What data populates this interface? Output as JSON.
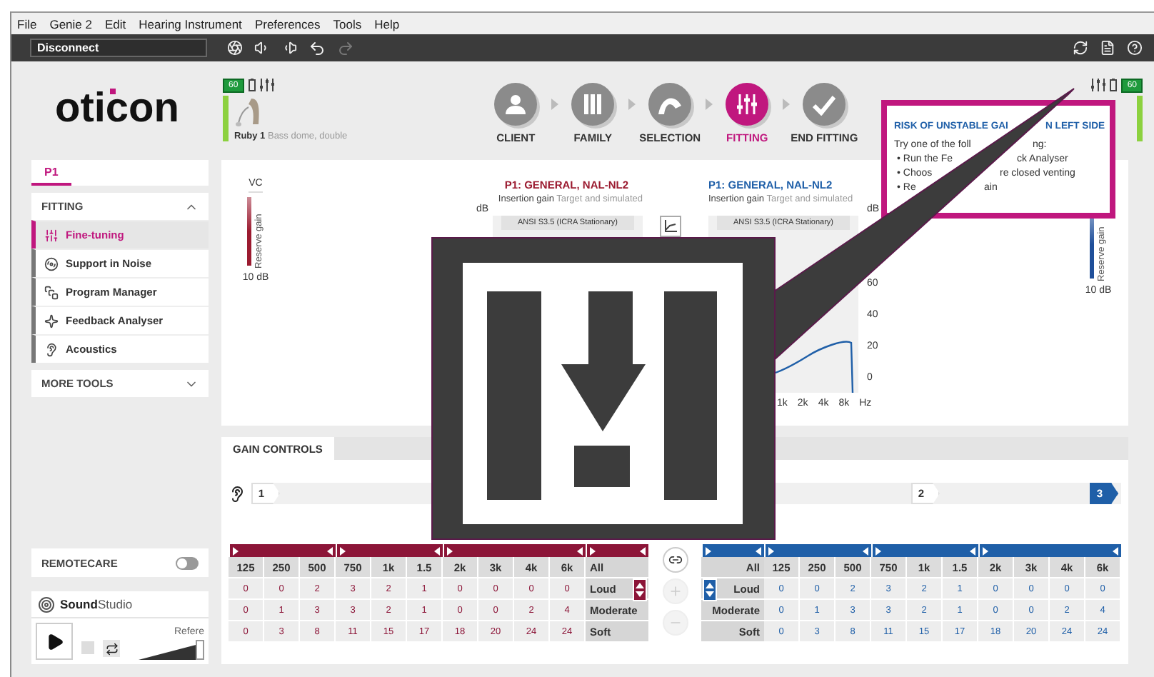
{
  "menu": [
    "File",
    "Genie 2",
    "Edit",
    "Hearing Instrument",
    "Preferences",
    "Tools",
    "Help"
  ],
  "toolbar": {
    "connection": "Disconnect",
    "redo_disabled": true
  },
  "logo": "oticon",
  "devices": [
    {
      "kind": "left",
      "battery": "60",
      "model": "Ruby 1",
      "fitting": "Bass dome, double"
    },
    {
      "kind": "right",
      "battery": "60"
    }
  ],
  "steps": [
    {
      "kind": "client",
      "label": "CLIENT",
      "selected": false
    },
    {
      "kind": "family",
      "label": "FAMILY",
      "selected": false
    },
    {
      "kind": "selection",
      "label": "SELECTION",
      "selected": false
    },
    {
      "kind": "fitting",
      "label": "FITTING",
      "selected": true
    },
    {
      "kind": "end",
      "label": "END FITTING",
      "selected": false
    }
  ],
  "program_tabs": [
    {
      "label": "P1",
      "selected": true
    }
  ],
  "fitting": {
    "title": "FITTING",
    "expanded": true,
    "items": [
      {
        "kind": "sliders",
        "label": "Fine-tuning",
        "selected": true
      },
      {
        "kind": "noise",
        "label": "Support in Noise",
        "selected": false
      },
      {
        "kind": "program",
        "label": "Program Manager",
        "selected": false
      },
      {
        "kind": "feedback",
        "label": "Feedback Analyser",
        "selected": false
      },
      {
        "kind": "acoustics",
        "label": "Acoustics",
        "selected": false
      }
    ]
  },
  "more_tools": {
    "title": "MORE TOOLS",
    "expanded": false
  },
  "remotecare": {
    "label": "REMOTECARE",
    "on": false
  },
  "sound_studio": {
    "brand_bold": "Sound",
    "brand_rest": "Studio",
    "reference": "Refere",
    "level": 1
  },
  "vc": [
    {
      "kind": "left",
      "label": "VC",
      "axis": "Reserve gain",
      "reading": "10 dB",
      "color": "#9b1b30"
    },
    {
      "kind": "right",
      "axis": "Reserve gain",
      "reading": "10 dB",
      "color": "#1f4f9a"
    }
  ],
  "graphs": [
    {
      "kind": "left",
      "title": "P1: GENERAL, NAL-NL2",
      "subtitle": "Insertion gain",
      "note": "Target and simulated",
      "unit": "dB",
      "standard": "ANSI S3.5 (ICRA Stationary)",
      "color": "#9b1b30"
    },
    {
      "kind": "right",
      "title": "P1: GENERAL, NAL-NL2",
      "subtitle": "Insertion gain",
      "note": "Target and simulated",
      "unit": "dB",
      "standard": "ANSI S3.5 (ICRA Stationary)",
      "color": "#1f5fa8",
      "y_ticks": [
        "60",
        "40",
        "20",
        "0"
      ],
      "x_ticks": [
        "1k",
        "2k",
        "4k",
        "8k"
      ],
      "x_unit": "Hz"
    }
  ],
  "gain_controls": {
    "tab": "GAIN CONTROLS",
    "steps": [
      {
        "label": "1",
        "selected": false
      },
      {
        "label": "2",
        "selected": false
      },
      {
        "label": "3",
        "selected": true
      }
    ],
    "tables": [
      {
        "kind": "left",
        "color": "#8c1538",
        "columns": [
          "125",
          "250",
          "500",
          "750",
          "1k",
          "1.5",
          "2k",
          "3k",
          "4k",
          "6k"
        ],
        "all": "All",
        "rows": [
          {
            "label": "Loud",
            "values": [
              "0",
              "0",
              "2",
              "3",
              "2",
              "1",
              "0",
              "0",
              "0",
              "0"
            ]
          },
          {
            "label": "Moderate",
            "values": [
              "0",
              "1",
              "3",
              "3",
              "2",
              "1",
              "0",
              "0",
              "2",
              "4"
            ]
          },
          {
            "label": "Soft",
            "values": [
              "0",
              "3",
              "8",
              "11",
              "15",
              "17",
              "18",
              "20",
              "24",
              "24"
            ]
          }
        ]
      },
      {
        "kind": "right",
        "color": "#1f5fa8",
        "columns": [
          "125",
          "250",
          "500",
          "750",
          "1k",
          "1.5",
          "2k",
          "3k",
          "4k",
          "6k"
        ],
        "all": "All",
        "rows": [
          {
            "label": "Loud",
            "values": [
              "0",
              "0",
              "2",
              "3",
              "2",
              "1",
              "0",
              "0",
              "0",
              "0"
            ]
          },
          {
            "label": "Moderate",
            "values": [
              "0",
              "1",
              "3",
              "3",
              "2",
              "1",
              "0",
              "0",
              "2",
              "4"
            ]
          },
          {
            "label": "Soft",
            "values": [
              "0",
              "3",
              "8",
              "11",
              "15",
              "17",
              "18",
              "20",
              "24",
              "24"
            ]
          }
        ]
      }
    ]
  },
  "tooltip": {
    "title": [
      "RISK OF UNSTABLE GAI",
      "N LEFT SIDE"
    ],
    "lines": [
      {
        "kind": "intro",
        "parts": [
          "Try one of the foll",
          "ng:"
        ]
      },
      {
        "kind": "bullet",
        "parts": [
          "• Run the Fe",
          "ck Analyser"
        ]
      },
      {
        "kind": "bullet",
        "parts": [
          "• Choos",
          "re closed venting"
        ]
      },
      {
        "kind": "bullet",
        "parts": [
          "• Re",
          "ain"
        ]
      }
    ]
  }
}
